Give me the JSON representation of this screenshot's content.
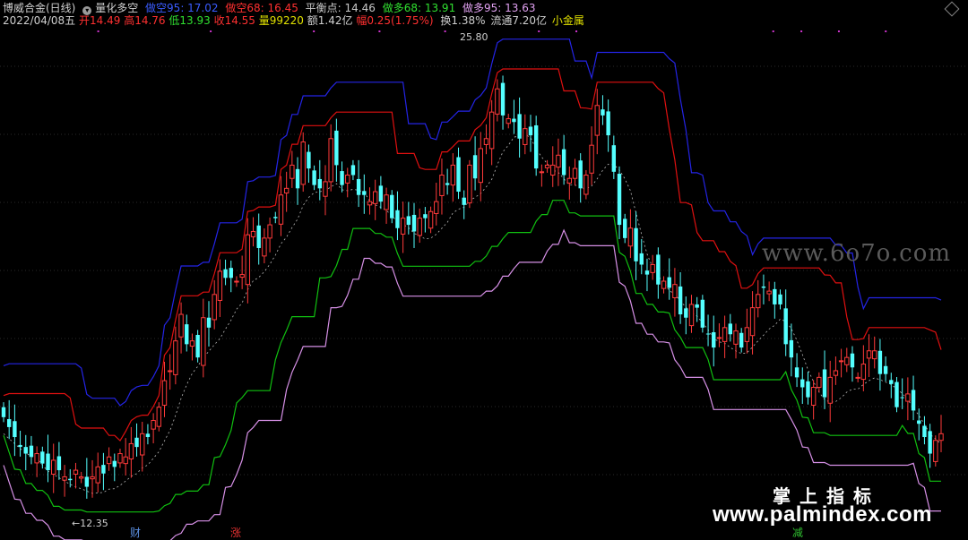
{
  "header": {
    "title": "博威合金(日线)",
    "indicator_icon": "circle-arrow-icon",
    "indicator_name": "量化多空",
    "short95": "做空95: 17.02",
    "short68": "做空68: 16.45",
    "balance": "平衡点: 14.46",
    "long68": "做多68: 13.91",
    "long95": "做多95: 13.63"
  },
  "quote": {
    "date": "2022/04/08五",
    "open": "开14.49",
    "high": "高14.76",
    "low": "低13.93",
    "close": "收14.55",
    "volume": "量99220",
    "amount": "额1.42亿",
    "change": "幅0.25(1.75%)",
    "turnover": "换1.38%",
    "float": "流通7.20亿",
    "sector": "小金属"
  },
  "annotations": {
    "max_label": "25.80",
    "min_label": "←12.35"
  },
  "events": [
    {
      "label": "财",
      "color": "#5b8fe0",
      "x": 0.138
    },
    {
      "label": "涨",
      "color": "#e03030",
      "x": 0.241
    },
    {
      "label": "减",
      "color": "#30c030",
      "x": 0.822
    }
  ],
  "watermark": "www.6o7o.com",
  "brand": {
    "name": "掌上指标",
    "url": "www.palmindex.com"
  },
  "colors": {
    "up": "#ff3a3a",
    "down": "#54ffff",
    "short95": "#2424e6",
    "short68": "#e01010",
    "long68": "#10c010",
    "long95": "#d690e6",
    "balance": "#b8b8b8",
    "dots": "#cc33cc"
  },
  "chart_data": {
    "type": "candlestick",
    "ylim": [
      11.8,
      26.6
    ],
    "n": 170,
    "closes": [
      15.1,
      14.8,
      14.5,
      14.2,
      14.0,
      13.9,
      14.0,
      13.7,
      13.5,
      13.8,
      13.5,
      13.3,
      13.2,
      13.5,
      13.3,
      13.0,
      13.3,
      13.6,
      13.4,
      13.9,
      13.6,
      14.0,
      13.9,
      14.3,
      14.2,
      14.6,
      14.5,
      15.0,
      15.4,
      16.2,
      16.5,
      17.4,
      18.2,
      17.3,
      17.4,
      16.9,
      18.1,
      17.8,
      18.8,
      19.5,
      19.3,
      19.3,
      19.2,
      19.4,
      20.6,
      20.7,
      20.2,
      20.5,
      20.9,
      21.1,
      21.8,
      22.0,
      22.7,
      22.0,
      23.4,
      22.6,
      22.1,
      22.0,
      22.2,
      23.5,
      22.7,
      22.1,
      22.4,
      22.4,
      21.8,
      21.8,
      21.6,
      21.9,
      21.6,
      21.8,
      21.1,
      20.8,
      21.1,
      20.9,
      20.7,
      21.1,
      21.1,
      21.3,
      21.6,
      22.4,
      22.1,
      22.7,
      21.9,
      21.5,
      22.7,
      22.3,
      23.2,
      23.5,
      24.3,
      25.0,
      24.2,
      24.1,
      24.0,
      23.5,
      23.8,
      23.6,
      22.6,
      22.5,
      22.7,
      22.7,
      23.0,
      22.4,
      22.3,
      22.6,
      22.0,
      22.4,
      23.3,
      24.5,
      24.2,
      23.6,
      22.5,
      20.9,
      20.5,
      20.8,
      19.8,
      19.7,
      19.4,
      19.7,
      19.1,
      19.2,
      19.0,
      19.1,
      18.2,
      18.1,
      18.5,
      18.4,
      17.8,
      17.6,
      17.2,
      17.5,
      17.8,
      17.6,
      17.7,
      17.2,
      17.8,
      18.4,
      18.8,
      19.0,
      18.9,
      18.5,
      18.5,
      17.3,
      16.9,
      16.3,
      16.0,
      15.7,
      16.0,
      16.3,
      15.7,
      16.3,
      16.5,
      16.8,
      16.9,
      16.6,
      16.3,
      16.7,
      17.1,
      17.1,
      16.4,
      16.4,
      16.1,
      15.4,
      15.7,
      15.8,
      15.3,
      14.9,
      14.5,
      14.0,
      14.4,
      14.6
    ],
    "series": [
      "short95",
      "short68",
      "balance",
      "long68",
      "long95"
    ]
  }
}
